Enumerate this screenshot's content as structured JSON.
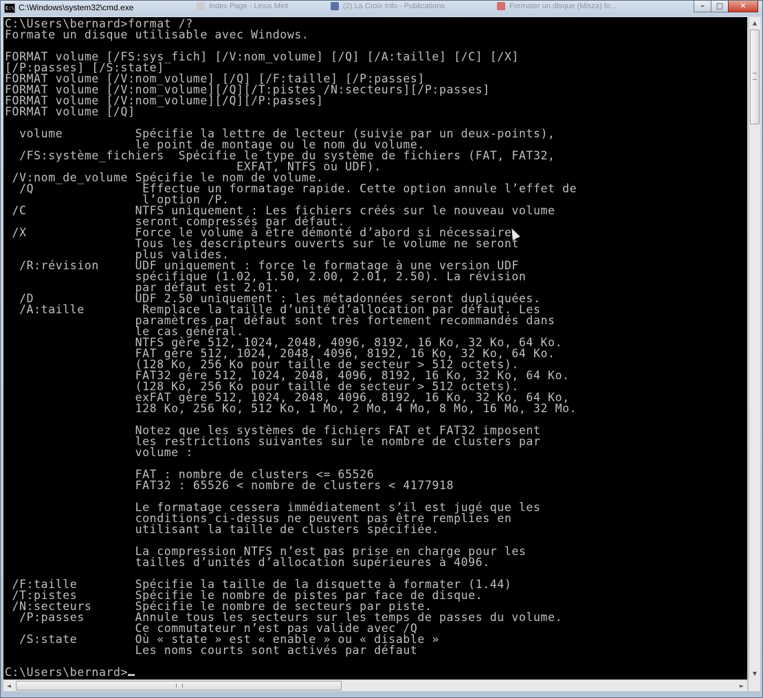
{
  "window": {
    "title": "C:\\Windows\\system32\\cmd.exe",
    "icon_label": "C:\\",
    "background_tabs": [
      {
        "label": "Index Page - Linux Mint",
        "favicon_color": "#c9c9c9"
      },
      {
        "label": "(2) La Croix Info - Publications",
        "favicon_color": "#3b5998"
      },
      {
        "label": "Formater un disque (Misza) fo...",
        "favicon_color": "#d9534f"
      }
    ],
    "buttons": {
      "minimize": "–",
      "maximize": "□",
      "close": "✕"
    }
  },
  "console": {
    "foreground_color": "#c0c0c0",
    "background_color": "#000000",
    "lines": [
      "C:\\Users\\bernard>format /?",
      "Formate un disque utilisable avec Windows.",
      "",
      "FORMAT volume [/FS:sys_fich] [/V:nom_volume] [/Q] [/A:taille] [/C] [/X]",
      "[/P:passes] [/S:state]",
      "FORMAT volume [/V:nom_volume] [/Q] [/F:taille] [/P:passes]",
      "FORMAT volume [/V:nom_volume][/Q][/T:pistes /N:secteurs][/P:passes]",
      "FORMAT volume [/V:nom_volume][/Q][/P:passes]",
      "FORMAT volume [/Q]",
      "",
      "  volume          Spécifie la lettre de lecteur (suivie par un deux-points),",
      "                  le point de montage ou le nom du volume.",
      "  /FS:système_fichiers  Spécifie le type du système de fichiers (FAT, FAT32,",
      "                                EXFAT, NTFS ou UDF).",
      " /V:nom_de_volume Spécifie le nom de volume.",
      "  /Q               Effectue un formatage rapide. Cette option annule l’effet de",
      "                   l’option /P.",
      " /C               NTFS uniquement : Les fichiers créés sur le nouveau volume",
      "                  seront compressés par défaut.",
      " /X               Force le volume à être démonté d’abord si nécessaire.",
      "                  Tous les descripteurs ouverts sur le volume ne seront",
      "                  plus valides.",
      "  /R:révision     UDF uniquement : force le formatage à une version UDF",
      "                  spécifique (1.02, 1.50, 2.00, 2.01, 2.50). La révision",
      "                  par défaut est 2.01.",
      "  /D              UDF 2.50 uniquement : les métadonnées seront dupliquées.",
      "  /A:taille        Remplace la taille d’unité d’allocation par défaut. Les",
      "                  paramètres par défaut sont très fortement recommandés dans",
      "                  le cas général.",
      "                  NTFS gère 512, 1024, 2048, 4096, 8192, 16 Ko, 32 Ko, 64 Ko.",
      "                  FAT gère 512, 1024, 2048, 4096, 8192, 16 Ko, 32 Ko, 64 Ko.",
      "                  (128 Ko, 256 Ko pour taille de secteur > 512 octets).",
      "                  FAT32 gère 512, 1024, 2048, 4096, 8192, 16 Ko, 32 Ko, 64 Ko.",
      "                  (128 Ko, 256 Ko pour taille de secteur > 512 octets).",
      "                  exFAT gère 512, 1024, 2048, 4096, 8192, 16 Ko, 32 Ko, 64 Ko,",
      "                  128 Ko, 256 Ko, 512 Ko, 1 Mo, 2 Mo, 4 Mo, 8 Mo, 16 Mo, 32 Mo.",
      "",
      "                  Notez que les systèmes de fichiers FAT et FAT32 imposent",
      "                  les restrictions suivantes sur le nombre de clusters par",
      "                  volume :",
      "",
      "                  FAT : nombre de clusters <= 65526",
      "                  FAT32 : 65526 < nombre de clusters < 4177918",
      "",
      "                  Le formatage cessera immédiatement s’il est jugé que les",
      "                  conditions ci-dessus ne peuvent pas être remplies en",
      "                  utilisant la taille de clusters spécifiée.",
      "",
      "                  La compression NTFS n’est pas prise en charge pour les",
      "                  tailles d’unités d’allocation supérieures à 4096.",
      "",
      " /F:taille        Spécifie la taille de la disquette à formater (1.44)",
      " /T:pistes        Spécifie le nombre de pistes par face de disque.",
      " /N:secteurs      Spécifie le nombre de secteurs par piste.",
      "  /P:passes       Annule tous les secteurs sur les temps de passes du volume.",
      "                  Ce commutateur n’est pas valide avec /Q",
      "  /S:state        Où « state » est « enable » ou « disable »",
      "                  Les noms courts sont activés par défaut",
      ""
    ],
    "prompt": "C:\\Users\\bernard>"
  },
  "scrollbars": {
    "vertical_up": "▲",
    "vertical_down": "▼",
    "horizontal_left": "◄",
    "horizontal_right": "►"
  }
}
